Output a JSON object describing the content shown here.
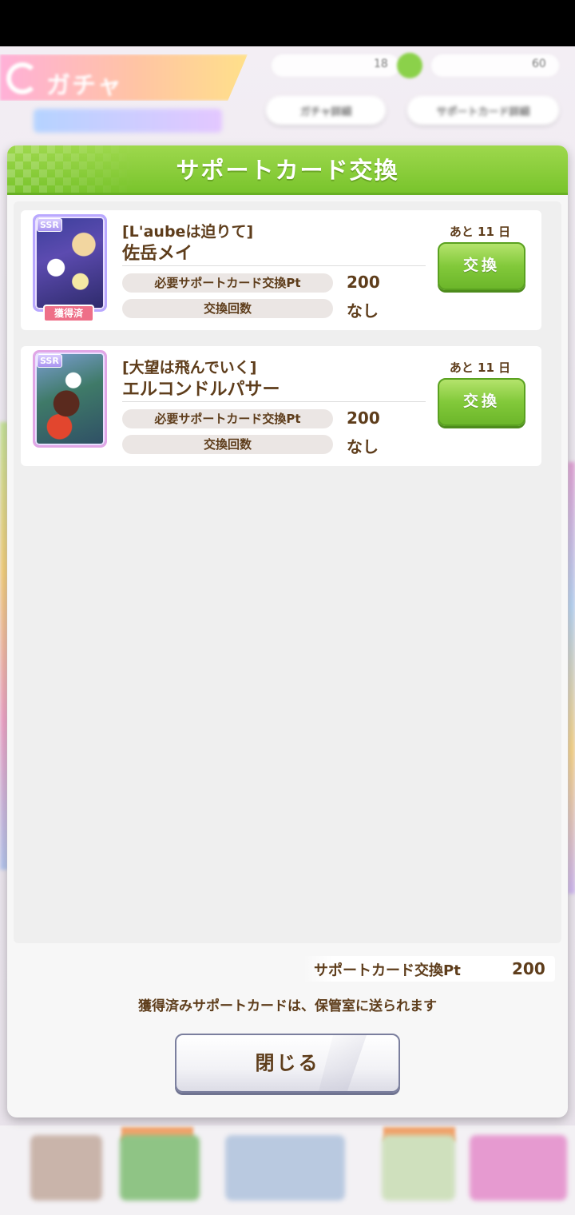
{
  "background": {
    "screen_title": "ガチャ",
    "resource_1": "18",
    "resource_2": "60",
    "pill_left": "ガチャ詳細",
    "pill_right": "サポートカード詳細"
  },
  "modal": {
    "title": "サポートカード交換",
    "cards": [
      {
        "rarity": "SSR",
        "title": "[L'aubeは迫りて]",
        "name": "佐岳メイ",
        "owned_label": "獲得済",
        "pt_label": "必要サポートカード交換Pt",
        "pt_value": "200",
        "count_label": "交換回数",
        "count_value": "なし",
        "remaining": "あと 11 日",
        "button": "交換"
      },
      {
        "rarity": "SSR",
        "title": "[大望は飛んでいく]",
        "name": "エルコンドルパサー",
        "pt_label": "必要サポートカード交換Pt",
        "pt_value": "200",
        "count_label": "交換回数",
        "count_value": "なし",
        "remaining": "あと 11 日",
        "button": "交換"
      }
    ],
    "points_label": "サポートカード交換Pt",
    "points_value": "200",
    "notice": "獲得済みサポートカードは、保管室に送られます",
    "close_button": "閉じる"
  }
}
